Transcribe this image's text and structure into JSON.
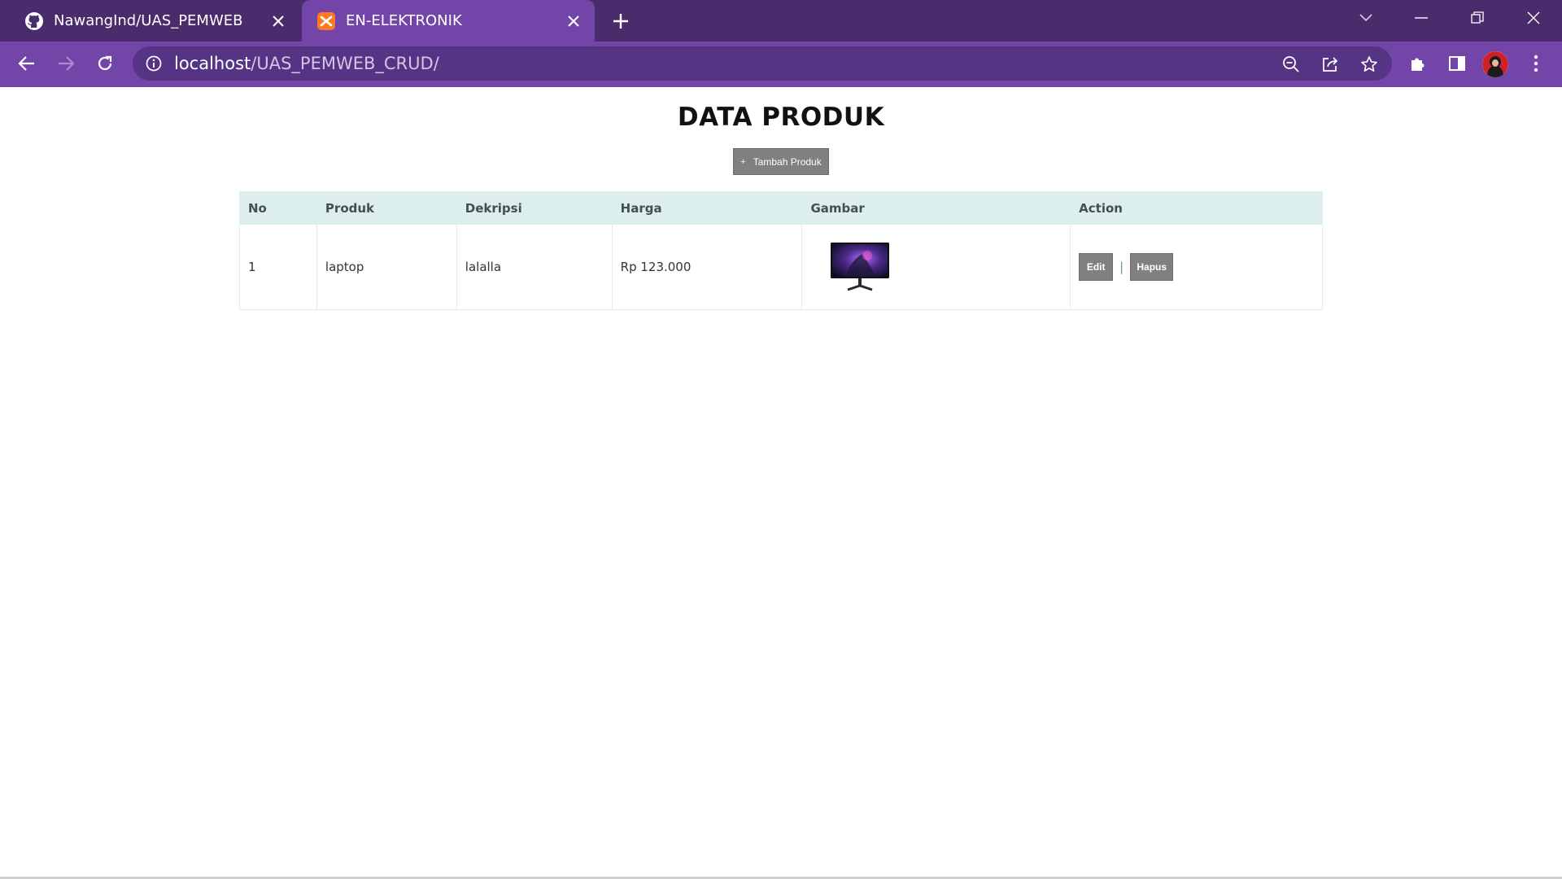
{
  "browser": {
    "tabs": [
      {
        "title": "NawangInd/UAS_PEMWEB",
        "favicon": "github-icon",
        "active": false
      },
      {
        "title": "EN-ELEKTRONIK",
        "favicon": "xampp-icon",
        "active": true
      }
    ],
    "url_host": "localhost",
    "url_path": "/UAS_PEMWEB_CRUD/",
    "colors": {
      "tabstrip": "#4a2b6b",
      "toolbar": "#7445a8",
      "omnibox": "#563485"
    }
  },
  "page": {
    "title": "DATA PRODUK",
    "add_button_icon": "+",
    "add_button_label": "Tambah Produk",
    "table": {
      "headers": [
        "No",
        "Produk",
        "Dekripsi",
        "Harga",
        "Gambar",
        "Action"
      ],
      "rows": [
        {
          "no": "1",
          "produk": "laptop",
          "deskripsi": "lalalla",
          "harga": "Rp 123.000",
          "gambar_alt": "monitor image"
        }
      ],
      "actions": {
        "edit": "Edit",
        "separator": "|",
        "delete": "Hapus"
      }
    }
  }
}
